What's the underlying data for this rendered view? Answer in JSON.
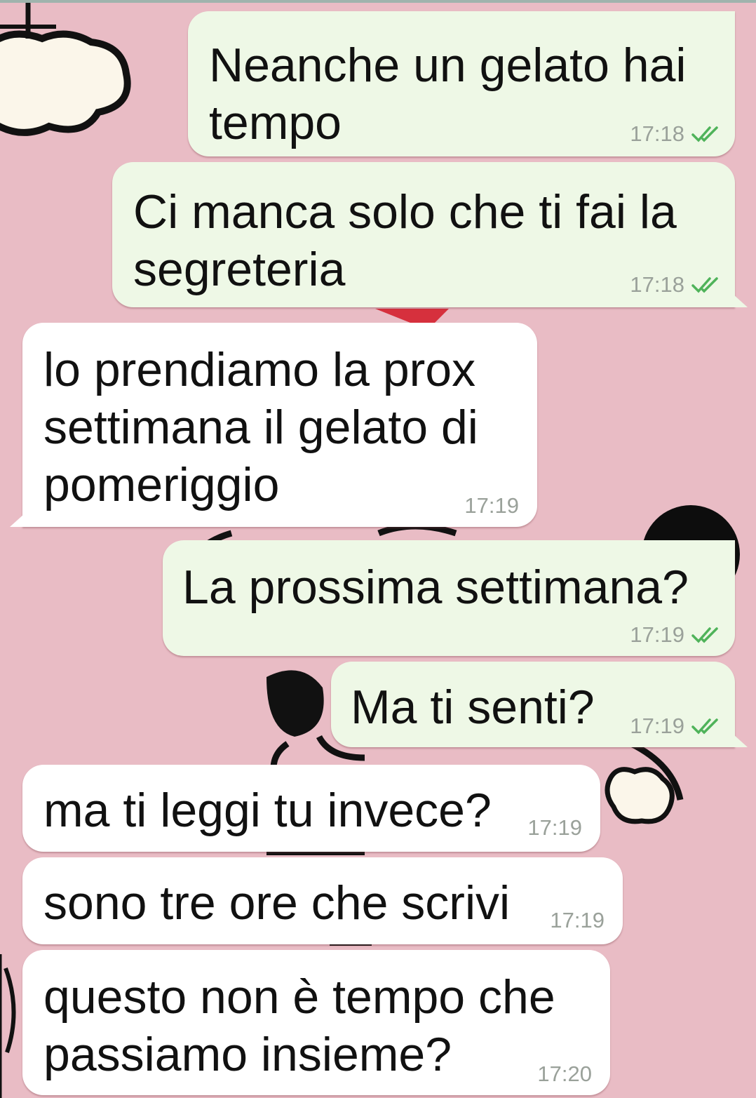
{
  "chat": {
    "messages": [
      {
        "dir": "out",
        "text": "Neanche un gelato hai\ntempo",
        "time": "17:18",
        "status": "read"
      },
      {
        "dir": "out",
        "text": "Ci manca solo che ti fai la\nsegreteria",
        "time": "17:18",
        "status": "read"
      },
      {
        "dir": "in",
        "text": "lo prendiamo la prox\nsettimana il gelato di\npomeriggio",
        "time": "17:19"
      },
      {
        "dir": "out",
        "text": "La prossima settimana?",
        "time": "17:19",
        "status": "read"
      },
      {
        "dir": "out",
        "text": "Ma ti senti?",
        "time": "17:19",
        "status": "read"
      },
      {
        "dir": "in",
        "text": "ma ti leggi tu invece?",
        "time": "17:19"
      },
      {
        "dir": "in",
        "text": "sono tre ore che scrivi",
        "time": "17:19"
      },
      {
        "dir": "in",
        "text": "questo non è tempo che\npassiamo insieme?",
        "time": "17:20"
      }
    ]
  },
  "colors": {
    "background": "#e9bcc5",
    "outgoing_bubble": "#eef8e6",
    "incoming_bubble": "#ffffff",
    "read_ticks": "#4fb35a",
    "timestamp": "#9aa19a"
  },
  "icons": {
    "read_receipt": "double-check-icon"
  }
}
